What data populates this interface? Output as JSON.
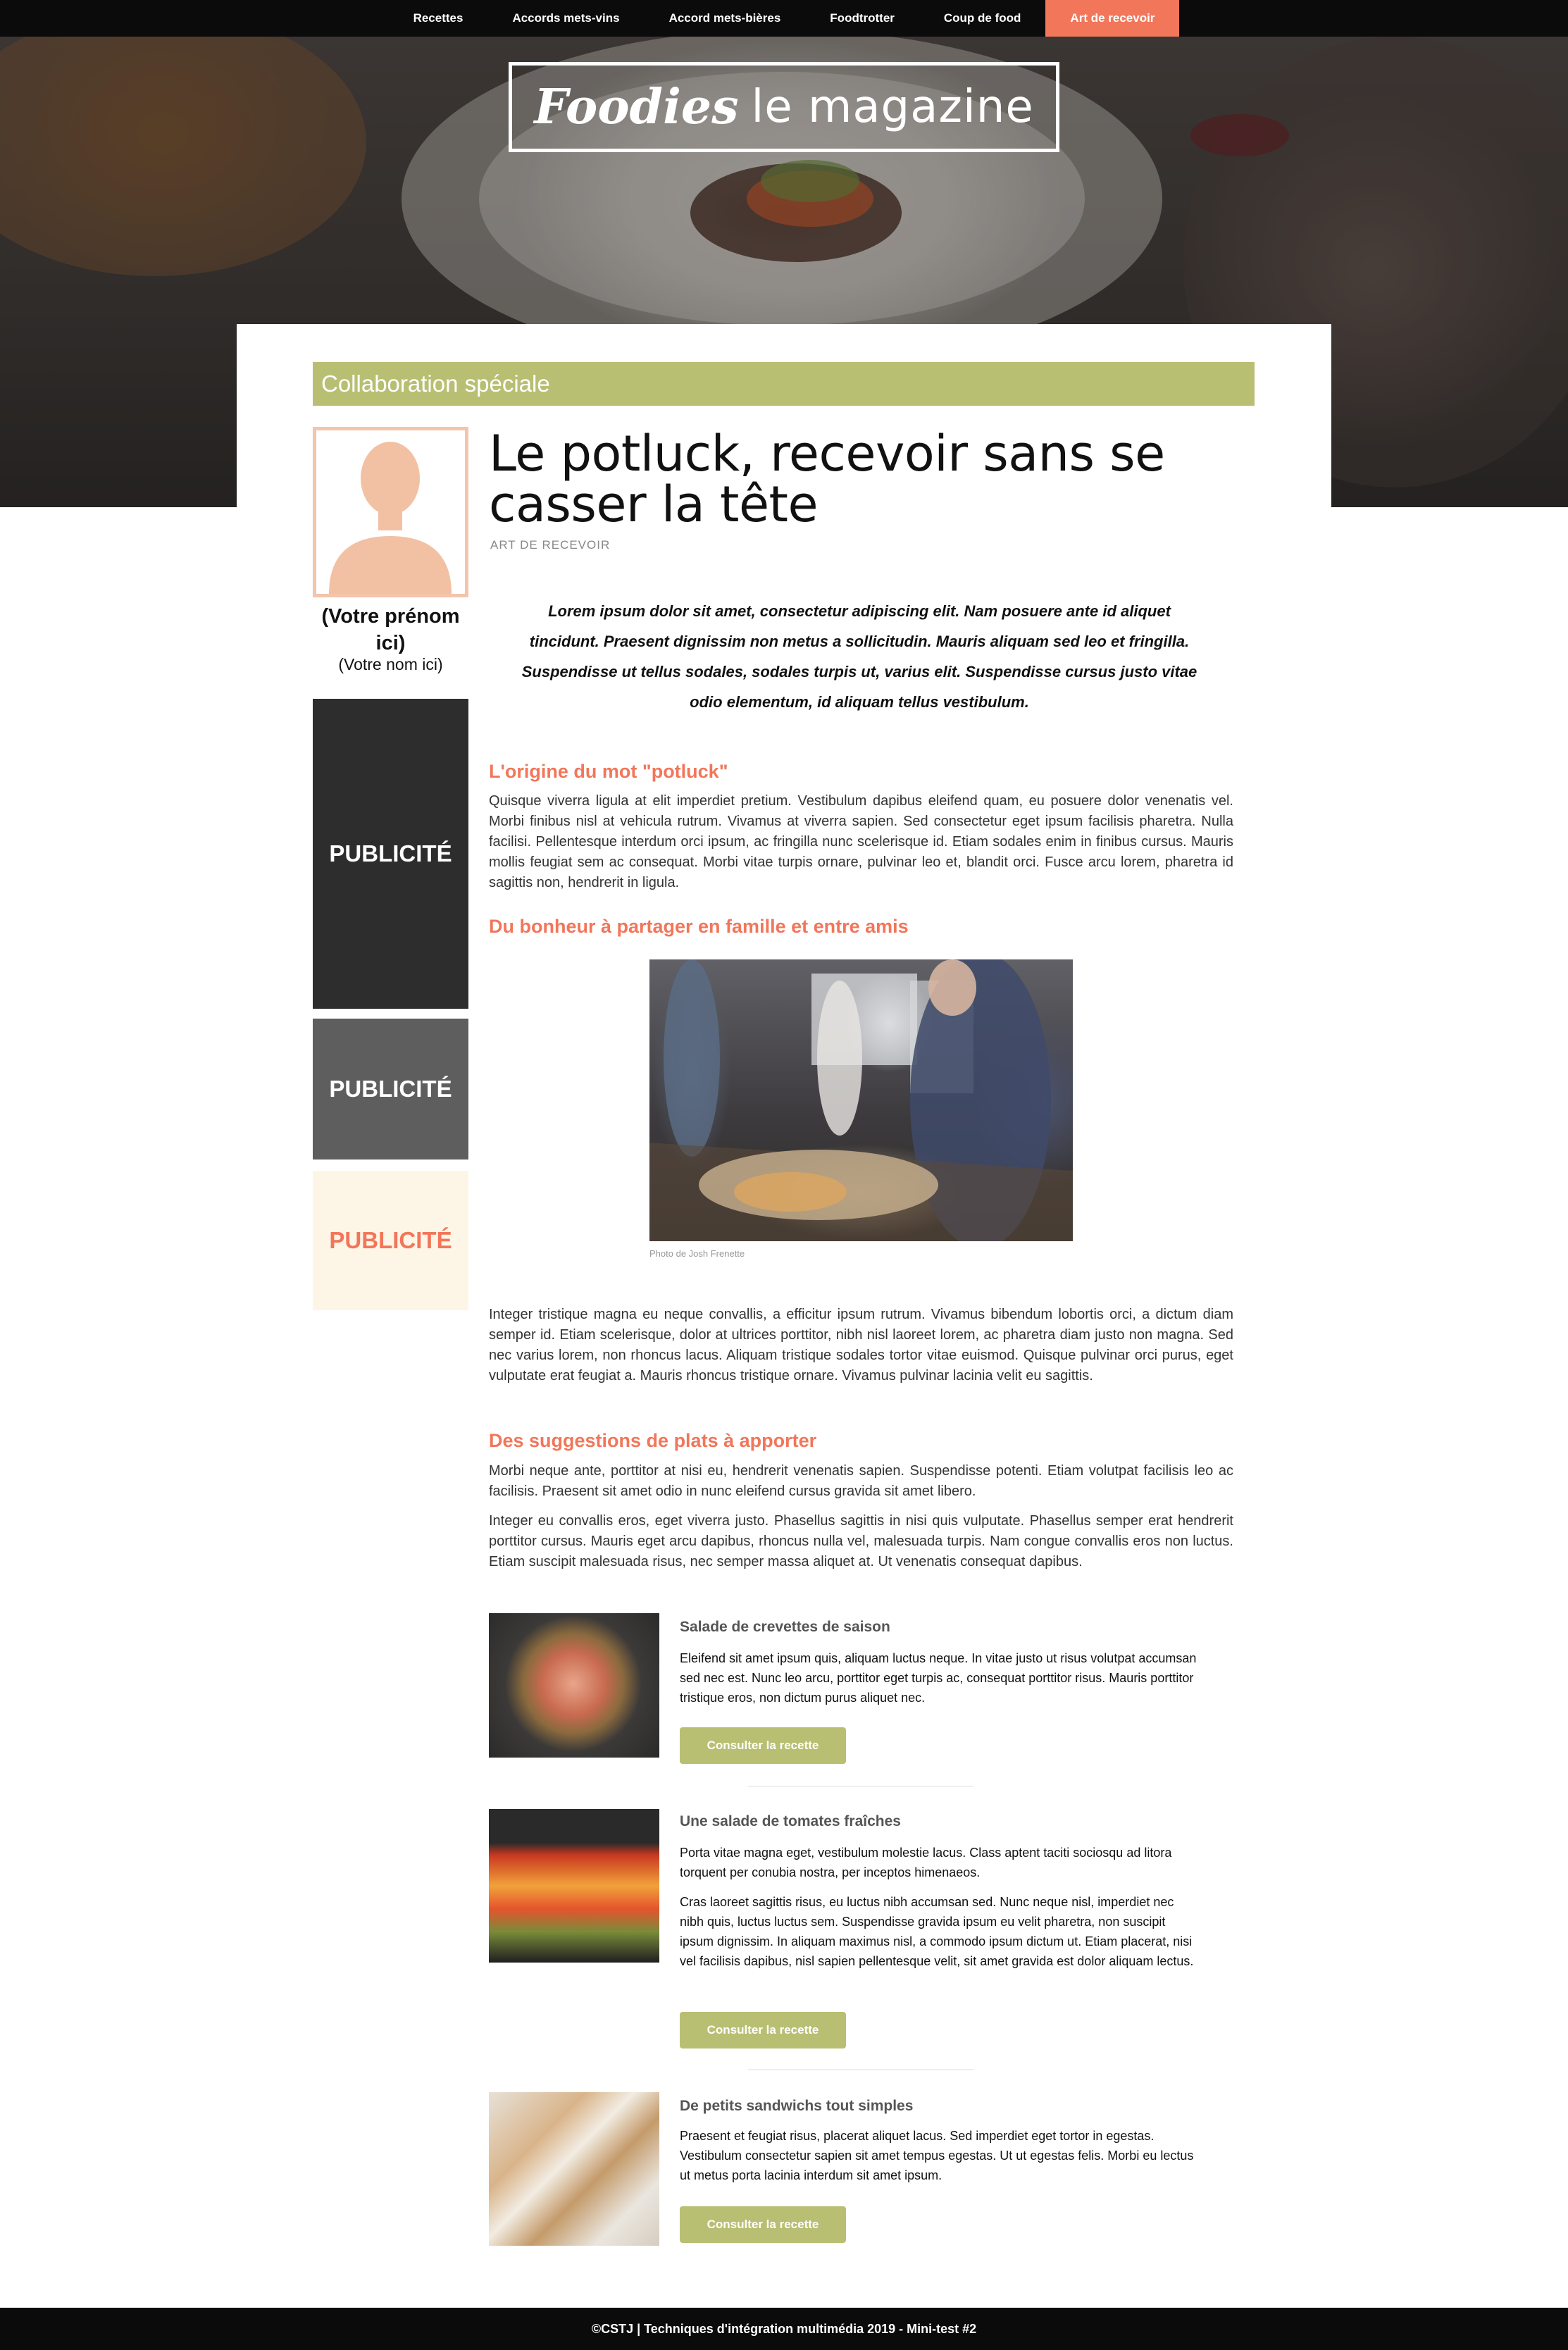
{
  "nav": {
    "items": [
      {
        "label": "Recettes"
      },
      {
        "label": "Accords mets-vins"
      },
      {
        "label": "Accord mets-bières"
      },
      {
        "label": "Foodtrotter"
      },
      {
        "label": "Coup de food"
      },
      {
        "label": "Art de recevoir"
      }
    ],
    "active": "Art de recevoir",
    "active_color": "#f2765a"
  },
  "header": {
    "logo_foodies": "Foodies",
    "logo_magazine": "le magazine"
  },
  "banner": {
    "label": "Collaboration spéciale",
    "color": "#b9bf72"
  },
  "author": {
    "avatar_icon": "user-silhouette-icon",
    "first_name": "(Votre prénom ici)",
    "last_name": "(Votre nom ici)"
  },
  "ads": [
    {
      "label": "PUBLICITÉ",
      "bg": "#2d2d2d",
      "fg": "#ffffff"
    },
    {
      "label": "PUBLICITÉ",
      "bg": "#5e5e5e",
      "fg": "#ffffff"
    },
    {
      "label": "PUBLICITÉ",
      "bg": "#fdf6e6",
      "fg": "#f2765a"
    }
  ],
  "article": {
    "title": "Le potluck, recevoir sans se casser la tête",
    "category": "ART DE RECEVOIR",
    "lead": "Lorem ipsum dolor sit amet, consectetur adipiscing elit. Nam posuere ante id aliquet tincidunt. Praesent dignissim non metus a sollicitudin. Mauris aliquam sed leo et fringilla. Suspendisse ut tellus sodales, sodales turpis ut, varius elit. Suspendisse cursus justo vitae odio elementum, id aliquam tellus vestibulum.",
    "section1_title": "L'origine du mot \"potluck\"",
    "section1_text": "Quisque viverra ligula at elit imperdiet pretium. Vestibulum dapibus eleifend quam, eu posuere dolor venenatis vel. Morbi finibus nisl at vehicula rutrum. Vivamus at viverra sapien. Sed consectetur eget ipsum facilisis pharetra. Nulla facilisi. Pellentesque interdum orci ipsum, ac fringilla nunc scelerisque id. Etiam sodales enim in finibus cursus. Mauris mollis feugiat sem ac consequat. Morbi vitae turpis ornare, pulvinar leo et, blandit orci. Fusce arcu lorem, pharetra id sagittis non, hendrerit in ligula.",
    "section2_title": "Du bonheur à partager en famille et entre amis",
    "photo_credit": "Photo de Josh Frenette",
    "section2_text": "Integer tristique magna eu neque convallis, a efficitur ipsum rutrum. Vivamus bibendum lobortis orci, a dictum diam semper id. Etiam scelerisque, dolor at ultrices porttitor, nibh nisl laoreet lorem, ac pharetra diam justo non magna. Sed nec varius lorem, non rhoncus lacus. Aliquam tristique sodales tortor vitae euismod. Quisque pulvinar orci purus, eget vulputate erat feugiat a. Mauris rhoncus tristique ornare. Vivamus pulvinar lacinia velit eu sagittis.",
    "section3_title": "Des suggestions de plats à apporter",
    "section3_text1": "Morbi neque ante, porttitor at nisi eu, hendrerit venenatis sapien. Suspendisse potenti. Etiam volutpat facilisis leo ac facilisis. Praesent sit amet odio in nunc eleifend cursus gravida sit amet libero.",
    "section3_text2": "Integer eu convallis eros, eget viverra justo. Phasellus sagittis in nisi quis vulputate. Phasellus semper erat hendrerit porttitor cursus. Mauris eget arcu dapibus, rhoncus nulla vel, malesuada turpis. Nam congue convallis eros non luctus. Etiam suscipit malesuada risus, nec semper massa aliquet at. Ut venenatis consequat dapibus."
  },
  "recipes": [
    {
      "title": "Salade de crevettes de saison",
      "text": "Eleifend sit amet ipsum quis, aliquam luctus neque. In vitae justo ut risus volutpat accumsan sed nec est. Nunc leo arcu, porttitor eget turpis ac, consequat porttitor risus. Mauris porttitor tristique eros, non dictum purus aliquet nec.",
      "button": "Consulter la recette"
    },
    {
      "title": "Une salade de tomates fraîches",
      "text": "Porta vitae magna eget, vestibulum molestie lacus. Class aptent taciti sociosqu ad litora torquent per conubia nostra, per inceptos himenaeos.",
      "text2": "Cras laoreet sagittis risus, eu luctus nibh accumsan sed. Nunc neque nisl, imperdiet nec nibh quis, luctus luctus sem. Suspendisse gravida ipsum eu velit pharetra, non suscipit ipsum dignissim. In aliquam maximus nisl, a commodo ipsum dictum ut. Etiam placerat, nisi vel facilisis dapibus, nisl sapien pellentesque velit, sit amet gravida est dolor aliquam lectus.",
      "button": "Consulter la recette"
    },
    {
      "title": "De petits sandwichs tout simples",
      "text": "Praesent et feugiat risus, placerat aliquet lacus. Sed imperdiet eget tortor in egestas. Vestibulum consectetur sapien sit amet tempus egestas. Ut ut egestas felis. Morbi eu lectus ut metus porta lacinia interdum sit amet ipsum.",
      "button": "Consulter la recette"
    }
  ],
  "footer": {
    "text": "©CSTJ | Techniques d'intégration multimédia 2019 - Mini-test #2"
  }
}
